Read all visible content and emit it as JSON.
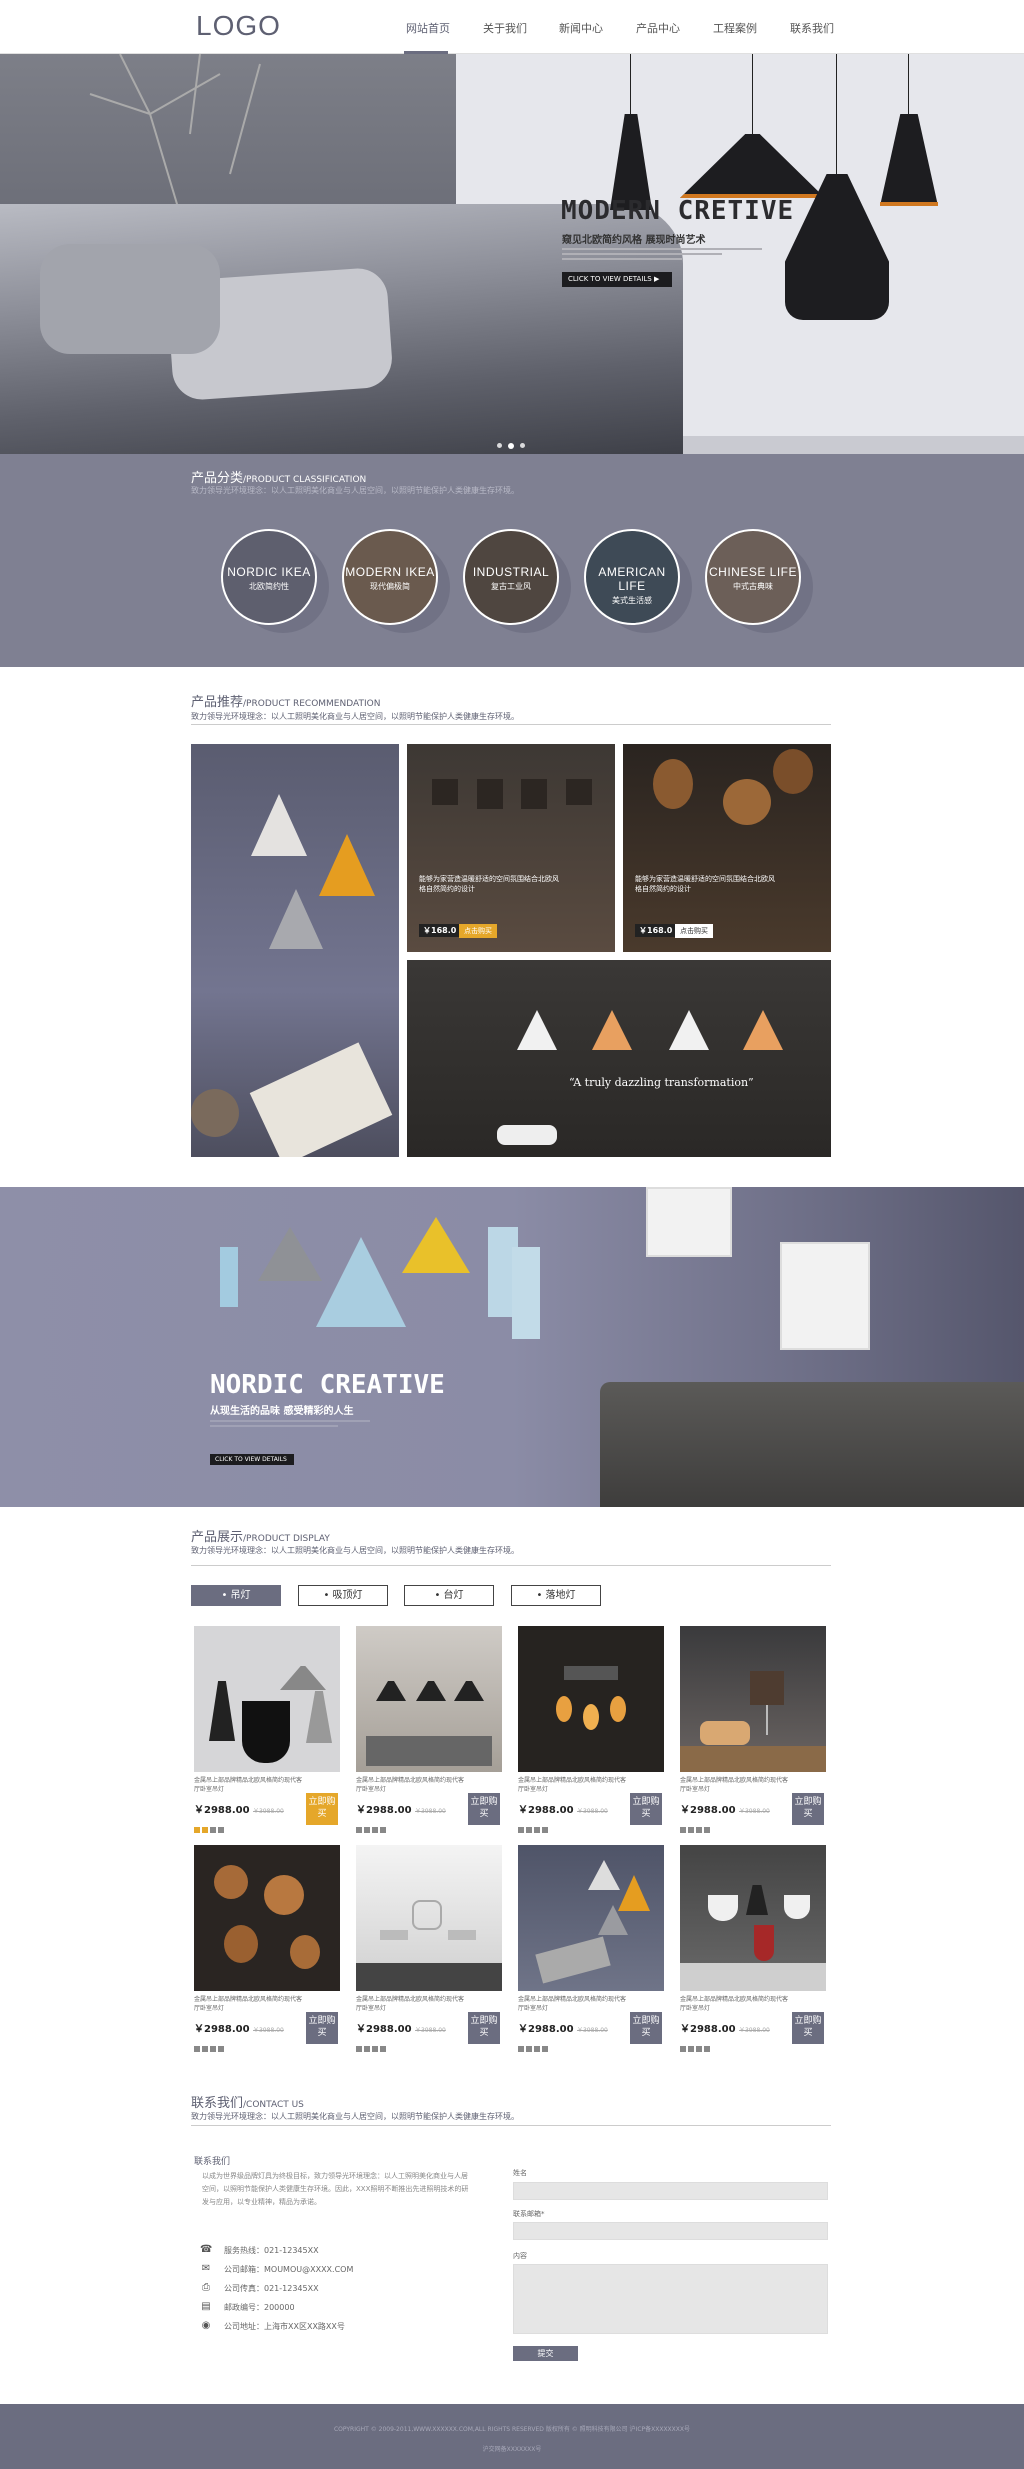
{
  "header": {
    "logo": "LOGO",
    "nav": [
      "网站首页",
      "关于我们",
      "新闻中心",
      "产品中心",
      "工程案例",
      "联系我们"
    ]
  },
  "hero": {
    "title": "MODERN CRETIVE",
    "subtitle": "窥见北欧简约风格 展现时尚艺术",
    "button": "CLICK TO VIEW DETAILS ▶"
  },
  "classification": {
    "title": "产品分类",
    "title_en": "/PRODUCT CLASSIFICATION",
    "desc": "致力领导光环境理念：以人工照明美化商业与人居空间，以照明节能保护人类健康生存环境。",
    "items": [
      {
        "en": "NORDIC IKEA",
        "cn": "北欧简约性"
      },
      {
        "en": "MODERN IKEA",
        "cn": "现代偏极简"
      },
      {
        "en": "INDUSTRIAL",
        "cn": "复古工业风"
      },
      {
        "en": "AMERICAN LIFE",
        "cn": "美式生活感"
      },
      {
        "en": "CHINESE LIFE",
        "cn": "中式古典味"
      }
    ]
  },
  "recommend": {
    "title": "产品推荐",
    "title_en": "/PRODUCT RECOMMENDATION",
    "desc": "致力领导光环境理念：以人工照明美化商业与人居空间，以照明节能保护人类健康生存环境。",
    "tile1": {
      "caption": "能够为家营造温暖舒适的空间氛围结合北欧风格自然简约的设计",
      "price": "￥168.0",
      "tag": "点击购买"
    },
    "tile2": {
      "caption": "能够为家营造温暖舒适的空间氛围结合北欧风格自然简约的设计",
      "price": "￥168.0",
      "tag": "点击购买"
    },
    "tile3": {
      "quote": "“A truly dazzling transformation”"
    }
  },
  "nordic": {
    "title": "NORDIC CREATIVE",
    "subtitle": "从现生活的品味 感受精彩的人生",
    "button": "CLICK TO VIEW DETAILS"
  },
  "display": {
    "title": "产品展示",
    "title_en": "/PRODUCT DISPLAY",
    "desc": "致力领导光环境理念：以人工照明美化商业与人居空间，以照明节能保护人类健康生存环境。",
    "tabs": [
      "吊灯",
      "吸顶灯",
      "台灯",
      "落地灯"
    ],
    "products": [
      {
        "desc": "金属吊上部品牌精品北欧风格简约现代客厅卧室吊灯",
        "price": "￥2988.00",
        "old": "￥3988.00",
        "buy": "立即购买"
      },
      {
        "desc": "金属吊上部品牌精品北欧风格简约现代客厅卧室吊灯",
        "price": "￥2988.00",
        "old": "￥3988.00",
        "buy": "立即购买"
      },
      {
        "desc": "金属吊上部品牌精品北欧风格简约现代客厅卧室吊灯",
        "price": "￥2988.00",
        "old": "￥3988.00",
        "buy": "立即购买"
      },
      {
        "desc": "金属吊上部品牌精品北欧风格简约现代客厅卧室吊灯",
        "price": "￥2988.00",
        "old": "￥3988.00",
        "buy": "立即购买"
      },
      {
        "desc": "金属吊上部品牌精品北欧风格简约现代客厅卧室吊灯",
        "price": "￥2988.00",
        "old": "￥3988.00",
        "buy": "立即购买"
      },
      {
        "desc": "金属吊上部品牌精品北欧风格简约现代客厅卧室吊灯",
        "price": "￥2988.00",
        "old": "￥3988.00",
        "buy": "立即购买"
      },
      {
        "desc": "金属吊上部品牌精品北欧风格简约现代客厅卧室吊灯",
        "price": "￥2988.00",
        "old": "￥3988.00",
        "buy": "立即购买"
      },
      {
        "desc": "金属吊上部品牌精品北欧风格简约现代客厅卧室吊灯",
        "price": "￥2988.00",
        "old": "￥3988.00",
        "buy": "立即购买"
      }
    ]
  },
  "contact": {
    "title": "联系我们",
    "title_en": "/CONTACT US",
    "desc": "致力领导光环境理念：以人工照明美化商业与人居空间，以照明节能保护人类健康生存环境。",
    "subtitle": "联系我们",
    "about": "以成为世界级品牌灯具为终极目标，致力领导光环境理念：以人工照明美化商业与人居空间，以照明节能保护人类健康生存环境。因此，XXX照明不断推出先进照明技术的研发与应用，以专业精神，精品为承诺。",
    "phone": "服务热线：021-12345XX",
    "email": "公司邮箱：MOUMOU@XXXX.COM",
    "fax": "公司传真：021-12345XX",
    "zip": "邮政编号：200000",
    "addr": "公司地址：上海市XX区XX路XX号",
    "form": {
      "name": "姓名",
      "email": "联系邮箱*",
      "message": "内容",
      "submit": "提交"
    }
  },
  "footer": {
    "line1": "COPYRIGHT © 2009-2011,WWW.XXXXXX.COM,ALL RIGHTS RESERVED 版权所有 © 照明科技有限公司 沪ICP备XXXXXXXX号",
    "line2": "沪交网备XXXXXXX号"
  }
}
